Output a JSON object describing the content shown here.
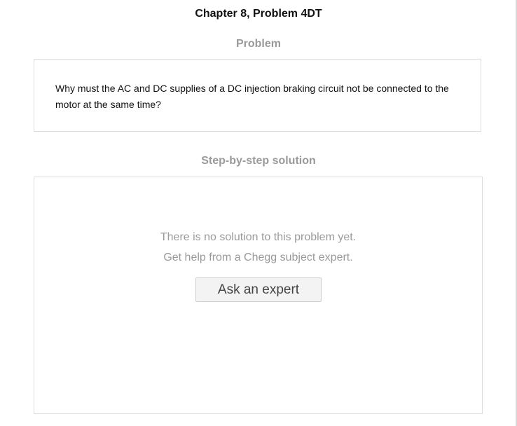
{
  "page": {
    "chapter_title": "Chapter 8, Problem 4DT"
  },
  "problem": {
    "heading": "Problem",
    "text": "Why must the AC and DC supplies of a DC injection braking circuit not be connected to the motor at the same time?"
  },
  "solution": {
    "heading": "Step-by-step solution",
    "empty_line_1": "There is no solution to this problem yet.",
    "empty_line_2": "Get help from a Chegg subject expert.",
    "ask_button_label": "Ask an expert"
  },
  "colors": {
    "heading_gray": "#9a9a9a",
    "border": "#dcdcdc",
    "button_bg": "#f3f3f3"
  }
}
